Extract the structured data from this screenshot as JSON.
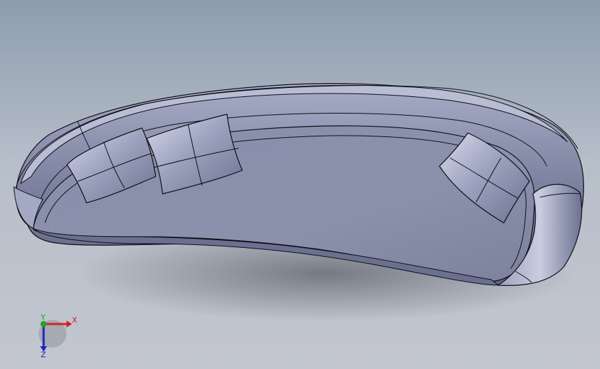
{
  "viewport": {
    "background_top": "#8f9eae",
    "background_mid": "#c9ced7",
    "background_bottom": "#bfc3cc",
    "model_color": "#7f86a3",
    "model_highlight": "#c7cbe0",
    "edge_color": "#0d0d14"
  },
  "model": {
    "parts": [
      "sofa-backrest",
      "sofa-seat",
      "cushion-1",
      "cushion-2",
      "cushion-3"
    ]
  },
  "triad": {
    "x_label": "X",
    "y_label": "Y",
    "z_label": "Z",
    "x_color": "#d42020",
    "y_color": "#1fa51f",
    "z_color": "#2020c8"
  }
}
